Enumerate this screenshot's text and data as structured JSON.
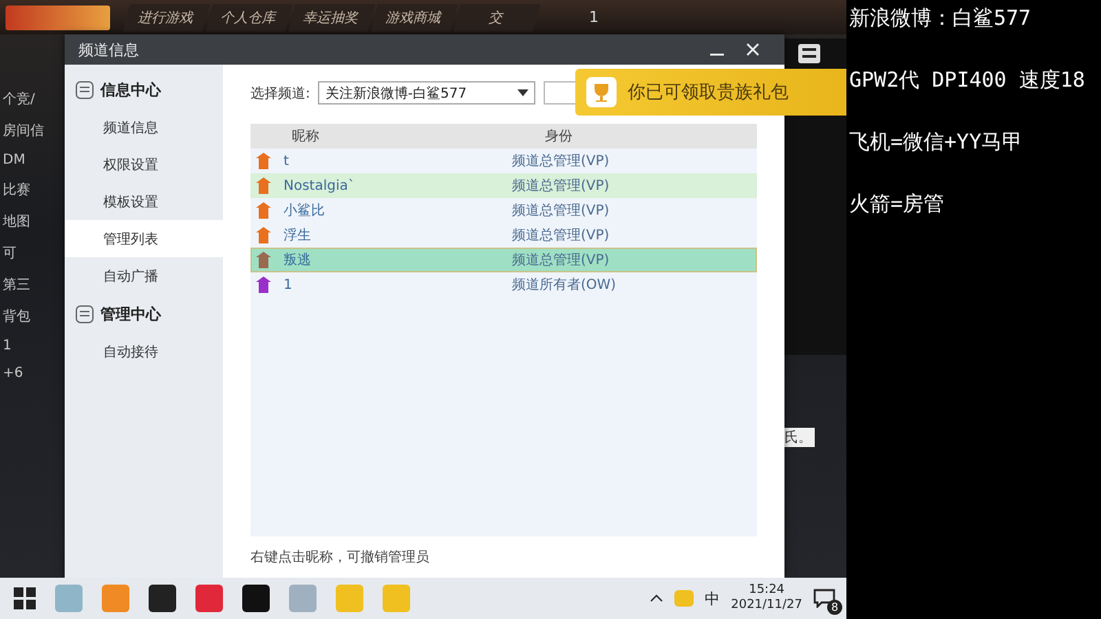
{
  "game": {
    "tabs": [
      "进行游戏",
      "个人仓库",
      "幸运抽奖",
      "游戏商城",
      "交"
    ],
    "counter": "1",
    "side_texts": [
      "个竞/",
      "房间信",
      "DM",
      "比赛",
      "地图",
      "可",
      "第三",
      "背包",
      "1",
      "+6"
    ],
    "note": "氏。"
  },
  "dialog": {
    "title": "频道信息",
    "nav": [
      {
        "kind": "heading",
        "label": "信息中心"
      },
      {
        "kind": "item",
        "label": "频道信息",
        "selected": false
      },
      {
        "kind": "item",
        "label": "权限设置",
        "selected": false
      },
      {
        "kind": "item",
        "label": "模板设置",
        "selected": false
      },
      {
        "kind": "item",
        "label": "管理列表",
        "selected": true
      },
      {
        "kind": "item",
        "label": "自动广播",
        "selected": false
      },
      {
        "kind": "heading",
        "label": "管理中心"
      },
      {
        "kind": "item",
        "label": "自动接待",
        "selected": false
      }
    ],
    "channel_label": "选择频道:",
    "channel_value": "关注新浪微博-白鲨577",
    "columns": [
      "昵称",
      "身份"
    ],
    "rows": [
      {
        "name": "t",
        "role": "频道总管理(VP)",
        "color": "#e8701e",
        "hovered": false,
        "selected": false
      },
      {
        "name": "Nostalgia`",
        "role": "频道总管理(VP)",
        "color": "#e8701e",
        "hovered": true,
        "selected": false
      },
      {
        "name": "小鲨比",
        "role": "频道总管理(VP)",
        "color": "#e8701e",
        "hovered": false,
        "selected": false
      },
      {
        "name": "浮生",
        "role": "频道总管理(VP)",
        "color": "#e8701e",
        "hovered": false,
        "selected": false
      },
      {
        "name": "叛逃",
        "role": "频道总管理(VP)",
        "color": "#9a6a50",
        "hovered": false,
        "selected": true
      },
      {
        "name": "1",
        "role": "频道所有者(OW)",
        "color": "#9b2fc9",
        "hovered": false,
        "selected": false
      }
    ],
    "hint": "右键点击昵称，可撤销管理员"
  },
  "popup": {
    "text": "你已可领取贵族礼包"
  },
  "overlay_lines": [
    "新浪微博：白鲨577",
    "GPW2代 DPI400 速度18",
    "飞机=微信+YY马甲",
    "火箭=房管"
  ],
  "taskbar": {
    "apps": [
      {
        "color": "#8fb5c8"
      },
      {
        "color": "#f08a24"
      },
      {
        "color": "#222222"
      },
      {
        "color": "#e0283a"
      },
      {
        "color": "#111111"
      },
      {
        "color": "#9fb0c0"
      },
      {
        "color": "#f0c020"
      },
      {
        "color": "#f0c020"
      }
    ],
    "ime": "中",
    "time": "15:24",
    "date": "2021/11/27",
    "notifications": "8"
  }
}
